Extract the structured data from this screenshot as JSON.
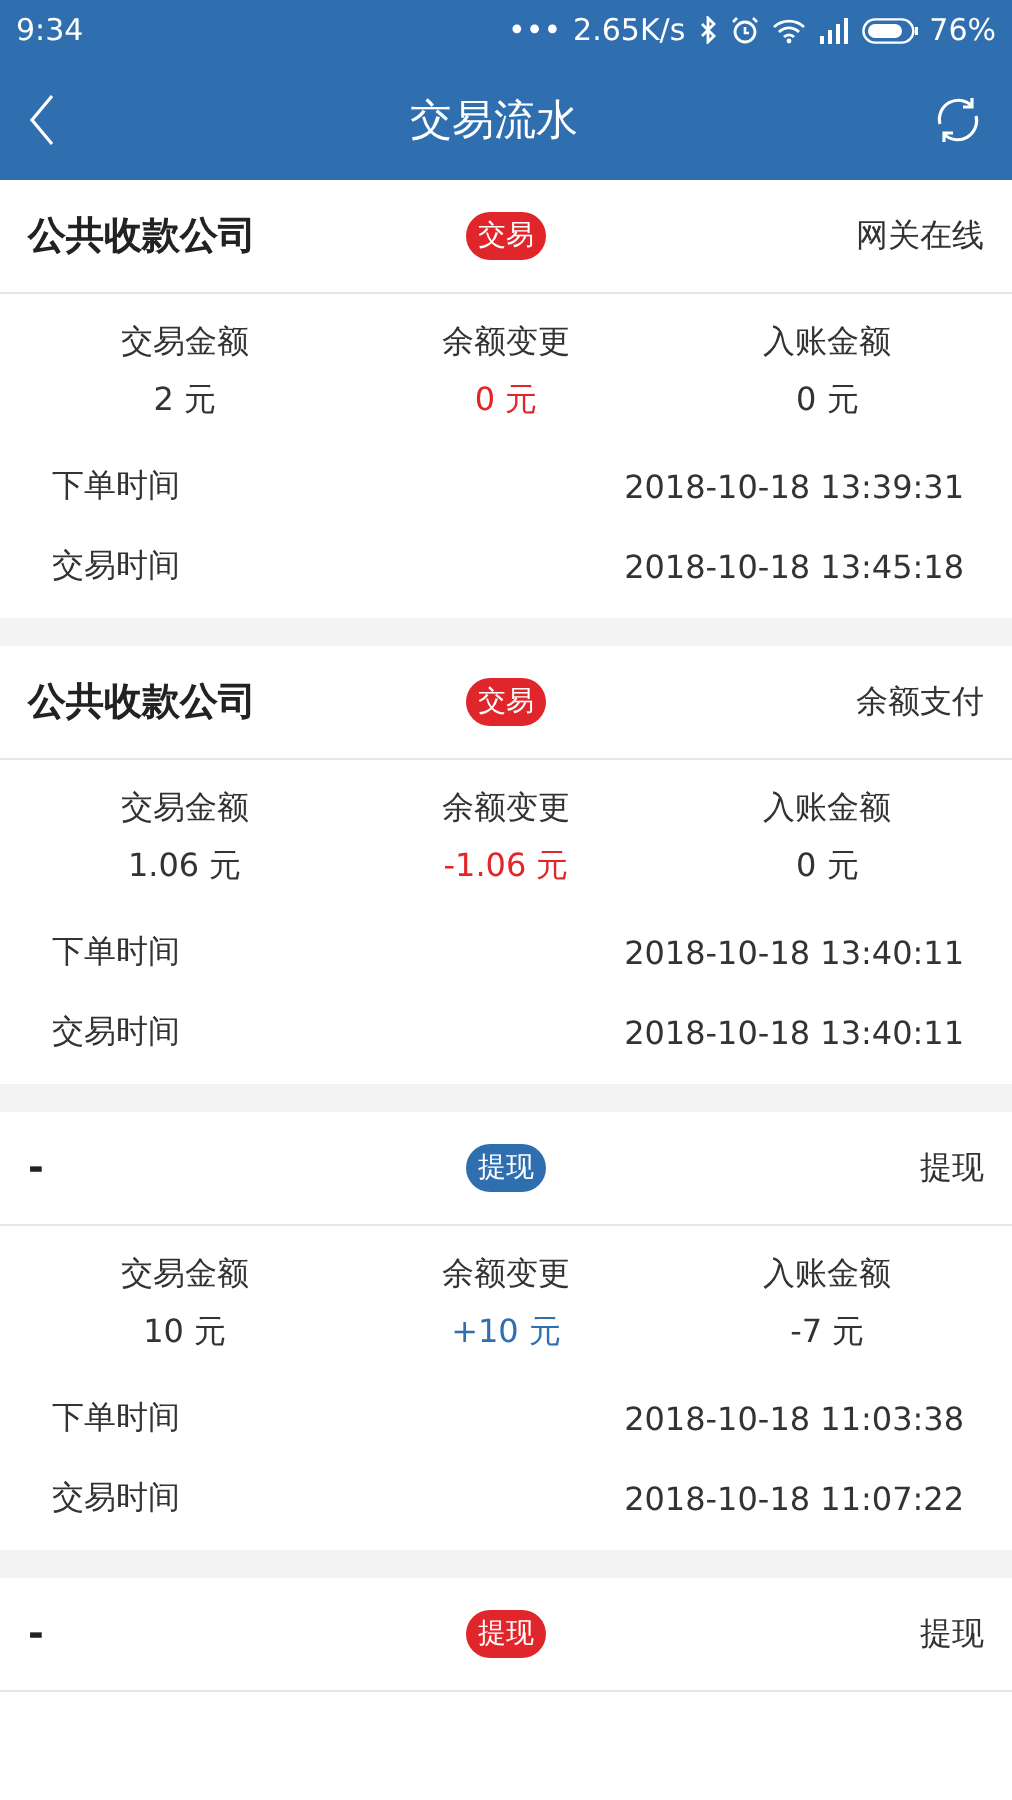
{
  "status_bar": {
    "time": "9:34",
    "dots": "•••",
    "speed": "2.65K/s",
    "battery_text": "76%"
  },
  "header": {
    "title": "交易流水"
  },
  "records": [
    {
      "company": "公共收款公司",
      "badge": {
        "text": "交易",
        "color": "#e0262b"
      },
      "channel": "网关在线",
      "stats": [
        {
          "label": "交易金额",
          "value": "2 元"
        },
        {
          "label": "余额变更",
          "value": "0 元",
          "color": "#e0262b"
        },
        {
          "label": "入账金额",
          "value": "0 元"
        }
      ],
      "times": [
        {
          "label": "下单时间",
          "value": "2018-10-18 13:39:31"
        },
        {
          "label": "交易时间",
          "value": "2018-10-18 13:45:18"
        }
      ]
    },
    {
      "company": "公共收款公司",
      "badge": {
        "text": "交易",
        "color": "#e0262b"
      },
      "channel": "余额支付",
      "stats": [
        {
          "label": "交易金额",
          "value": "1.06 元"
        },
        {
          "label": "余额变更",
          "value": "-1.06 元",
          "color": "#e0262b"
        },
        {
          "label": "入账金额",
          "value": "0 元"
        }
      ],
      "times": [
        {
          "label": "下单时间",
          "value": "2018-10-18 13:40:11"
        },
        {
          "label": "交易时间",
          "value": "2018-10-18 13:40:11"
        }
      ]
    },
    {
      "company": "-",
      "badge": {
        "text": "提现",
        "color": "#2f6fb0"
      },
      "channel": "提现",
      "stats": [
        {
          "label": "交易金额",
          "value": "10 元"
        },
        {
          "label": "余额变更",
          "value": "+10 元",
          "color": "#2f6fb0"
        },
        {
          "label": "入账金额",
          "value": "-7 元"
        }
      ],
      "times": [
        {
          "label": "下单时间",
          "value": "2018-10-18 11:03:38"
        },
        {
          "label": "交易时间",
          "value": "2018-10-18 11:07:22"
        }
      ]
    },
    {
      "company": "-",
      "badge": {
        "text": "提现",
        "color": "#e0262b"
      },
      "channel": "提现"
    }
  ]
}
